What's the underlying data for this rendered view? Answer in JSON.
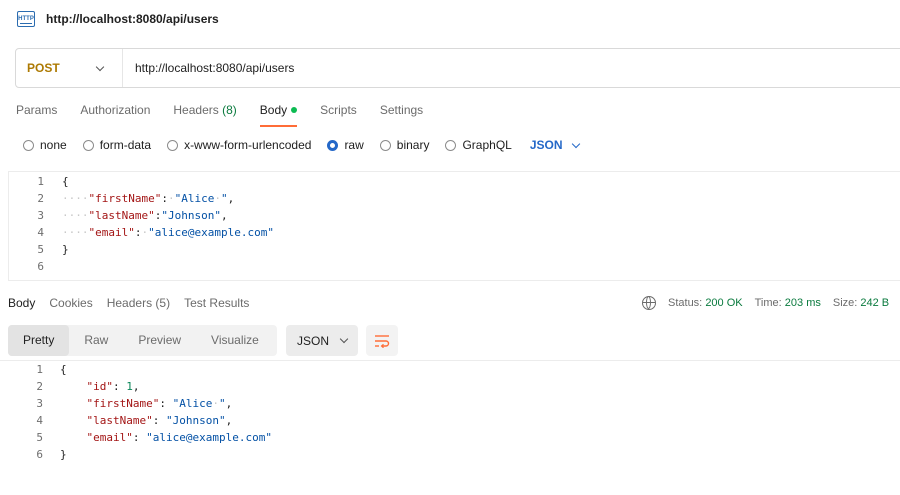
{
  "header": {
    "icon": "http-request-icon",
    "title": "http://localhost:8080/api/users",
    "icon_text": "HTTP"
  },
  "request": {
    "method": "POST",
    "url": "http://localhost:8080/api/users",
    "tabs": [
      {
        "label": "Params"
      },
      {
        "label": "Authorization"
      },
      {
        "label": "Headers",
        "count": "(8)"
      },
      {
        "label": "Body",
        "active": true
      },
      {
        "label": "Scripts"
      },
      {
        "label": "Settings"
      }
    ],
    "body_types": [
      "none",
      "form-data",
      "x-www-form-urlencoded",
      "raw",
      "binary",
      "GraphQL"
    ],
    "selected_body_type": "raw",
    "format": "JSON",
    "body_lines": [
      {
        "n": "1",
        "text": "{"
      },
      {
        "n": "2",
        "text": "    \"firstName\": \"Alice \","
      },
      {
        "n": "3",
        "text": "    \"lastName\":\"Johnson\","
      },
      {
        "n": "4",
        "text": "    \"email\": \"alice@example.com\""
      },
      {
        "n": "5",
        "text": "}"
      },
      {
        "n": "6",
        "text": ""
      }
    ]
  },
  "response": {
    "tabs": [
      {
        "label": "Body",
        "active": true
      },
      {
        "label": "Cookies"
      },
      {
        "label": "Headers (5)"
      },
      {
        "label": "Test Results"
      }
    ],
    "status_label": "Status:",
    "status_value": "200 OK",
    "time_label": "Time:",
    "time_value": "203 ms",
    "size_label": "Size:",
    "size_value": "242 B",
    "view_tabs": [
      "Pretty",
      "Raw",
      "Preview",
      "Visualize"
    ],
    "format": "JSON",
    "body_lines": [
      {
        "n": "1",
        "text": "{"
      },
      {
        "n": "2",
        "text": "    \"id\": 1,"
      },
      {
        "n": "3",
        "text": "    \"firstName\": \"Alice \","
      },
      {
        "n": "4",
        "text": "    \"lastName\": \"Johnson\","
      },
      {
        "n": "5",
        "text": "    \"email\": \"alice@example.com\""
      },
      {
        "n": "6",
        "text": "}"
      }
    ]
  }
}
